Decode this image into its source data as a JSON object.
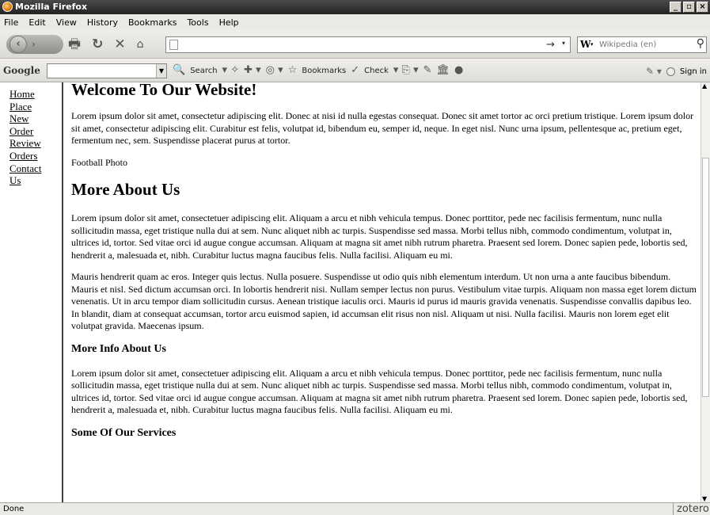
{
  "window": {
    "title": "Mozilla Firefox",
    "minimize": "_",
    "maximize": "▫",
    "close": "×"
  },
  "menu": [
    "File",
    "Edit",
    "View",
    "History",
    "Bookmarks",
    "Tools",
    "Help"
  ],
  "navbar": {
    "back_glyph": "‹",
    "forward_glyph": "›",
    "url": "",
    "search_engine": "W",
    "search_placeholder": "Wikipedia (en)"
  },
  "google_toolbar": {
    "logo": "Google",
    "search_label": "Search",
    "bookmarks_label": "Bookmarks",
    "check_label": "Check",
    "signin_label": "Sign in"
  },
  "sidebar": {
    "links": [
      "Home",
      "Place",
      "New",
      "Order",
      "Review",
      "Orders",
      "Contact",
      "Us"
    ]
  },
  "page": {
    "h1": "Welcome To Our Website!",
    "p1": "Lorem ipsum dolor sit amet, consectetur adipiscing elit. Donec at nisi id nulla egestas consequat. Donec sit amet tortor ac orci pretium tristique. Lorem ipsum dolor sit amet, consectetur adipiscing elit. Curabitur est felis, volutpat id, bibendum eu, semper id, neque. In eget nisl. Nunc urna ipsum, pellentesque ac, pretium eget, fermentum nec, sem. Suspendisse placerat purus at tortor.",
    "photo_alt": "Football Photo",
    "h2": "More About Us",
    "p2": "Lorem ipsum dolor sit amet, consectetuer adipiscing elit. Aliquam a arcu et nibh vehicula tempus. Donec porttitor, pede nec facilisis fermentum, nunc nulla sollicitudin massa, eget tristique nulla dui at sem. Nunc aliquet nibh ac turpis. Suspendisse sed massa. Morbi tellus nibh, commodo condimentum, volutpat in, ultrices id, tortor. Sed vitae orci id augue congue accumsan. Aliquam at magna sit amet nibh rutrum pharetra. Praesent sed lorem. Donec sapien pede, lobortis sed, hendrerit a, malesuada et, nibh. Curabitur luctus magna faucibus felis. Nulla facilisi. Aliquam eu mi.",
    "p3": "Mauris hendrerit quam ac eros. Integer quis lectus. Nulla posuere. Suspendisse ut odio quis nibh elementum interdum. Ut non urna a ante faucibus bibendum. Mauris et nisl. Sed dictum accumsan orci. In lobortis hendrerit nisi. Nullam semper lectus non purus. Vestibulum vitae turpis. Aliquam non massa eget lorem dictum venenatis. Ut in arcu tempor diam sollicitudin cursus. Aenean tristique iaculis orci. Mauris id purus id mauris gravida venenatis. Suspendisse convallis dapibus leo. In blandit, diam at consequat accumsan, tortor arcu euismod sapien, id accumsan elit risus non nisl. Aliquam ut nisi. Nulla facilisi. Mauris non lorem eget elit volutpat gravida. Maecenas ipsum.",
    "h3a": "More Info About Us",
    "p4": "Lorem ipsum dolor sit amet, consectetuer adipiscing elit. Aliquam a arcu et nibh vehicula tempus. Donec porttitor, pede nec facilisis fermentum, nunc nulla sollicitudin massa, eget tristique nulla dui at sem. Nunc aliquet nibh ac turpis. Suspendisse sed massa. Morbi tellus nibh, commodo condimentum, volutpat in, ultrices id, tortor. Sed vitae orci id augue congue accumsan. Aliquam at magna sit amet nibh rutrum pharetra. Praesent sed lorem. Donec sapien pede, lobortis sed, hendrerit a, malesuada et, nibh. Curabitur luctus magna faucibus felis. Nulla facilisi. Aliquam eu mi.",
    "h3b": "Some Of Our Services"
  },
  "status": {
    "text": "Done",
    "addon": "zotero"
  }
}
